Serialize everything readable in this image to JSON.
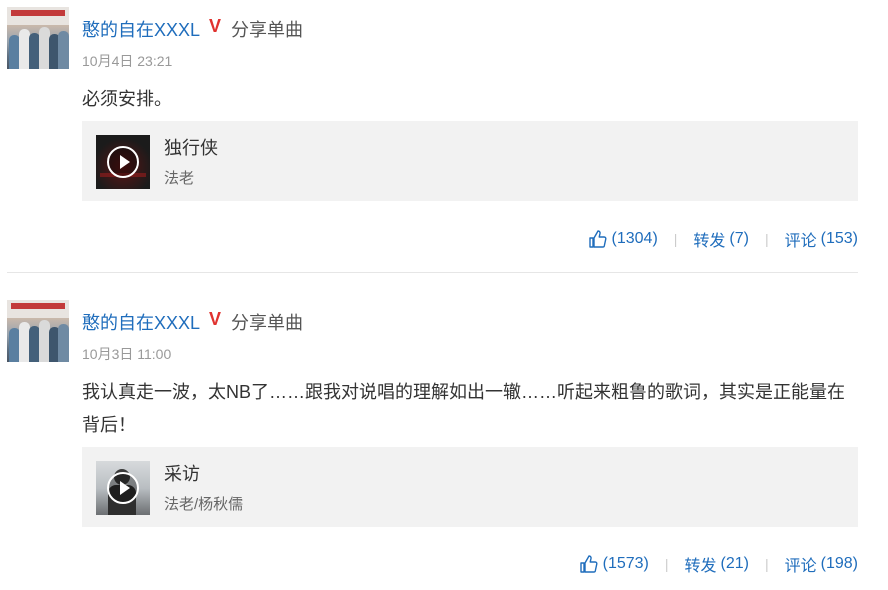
{
  "posts": [
    {
      "username": "憨的自在XXXL",
      "verified_badge": "V",
      "action": "分享单曲",
      "time": "10月4日 23:21",
      "content": "必须安排。",
      "song": {
        "title": "独行侠",
        "artist": "法老",
        "cover_colors": [
          "#1b1b1b",
          "#8a1d1d"
        ]
      },
      "likes": "(1304)",
      "repost_label": "转发",
      "repost_count": "(7)",
      "comment_label": "评论",
      "comment_count": "(153)"
    },
    {
      "username": "憨的自在XXXL",
      "verified_badge": "V",
      "action": "分享单曲",
      "time": "10月3日 11:00",
      "content": "我认真走一波，太NB了……跟我对说唱的理解如出一辙……听起来粗鲁的歌词，其实是正能量在背后！",
      "song": {
        "title": "采访",
        "artist": "法老/杨秋儒",
        "cover_colors": [
          "#c9cdd0",
          "#3b3b3b"
        ]
      },
      "likes": "(1573)",
      "repost_label": "转发",
      "repost_count": "(21)",
      "comment_label": "评论",
      "comment_count": "(198)"
    }
  ],
  "colors": {
    "link": "#1f6dbc",
    "badge": "#e0322f",
    "card_bg": "#f2f2f2"
  },
  "icons": {
    "like": "thumbs-up-icon",
    "play": "play-icon",
    "verified": "verified-v-icon"
  }
}
